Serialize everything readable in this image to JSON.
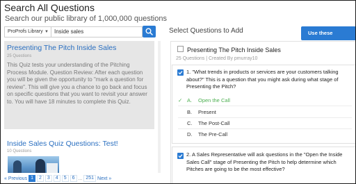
{
  "header": {
    "title": "Search All Questions",
    "subtitle": "Search our public library of 1,000,000 questions"
  },
  "search": {
    "library_label": "ProProfs Library",
    "query": "Inside sales"
  },
  "results": [
    {
      "title": "Presenting The Pitch Inside Sales",
      "count": "25 Questions",
      "description": "This Quiz tests your understanding of the Pitching Process Module. Question Review:  After each question you will be given the opportunity to \"mark a question for review\". This will give you a chance to go back and focus on specific questions that you want to revisit your answer to. You will have 18 minutes to complete this Quiz."
    },
    {
      "title": "Inside Sales Quiz Questions: Test!",
      "count": "10 Questions"
    }
  ],
  "pagination": {
    "prev": "« Previous",
    "pages": [
      "1",
      "2",
      "3",
      "4",
      "5",
      "6"
    ],
    "ellipsis": "...",
    "last": "251",
    "next": "Next »"
  },
  "selection": {
    "heading": "Select Questions to Add",
    "use_button": "Use these questions",
    "quiz_title": "Presenting The Pitch Inside Sales",
    "quiz_meta": "25 Questions | Created By pmurray10",
    "questions": [
      {
        "number": "1.",
        "text": "\"What trends in products or services are your customers talking about?\" This is a question that you might ask during what stage of Presenting the Pitch?",
        "options": [
          {
            "letter": "A.",
            "text": "Open the Call",
            "correct": true
          },
          {
            "letter": "B.",
            "text": "Present",
            "correct": false
          },
          {
            "letter": "C.",
            "text": "The Post-Call",
            "correct": false
          },
          {
            "letter": "D.",
            "text": "The Pre-Call",
            "correct": false
          }
        ]
      },
      {
        "number": "2.",
        "text": "A Sales Representative will ask questions in the \"Open the Inside Sales Call\" stage of Presenting the Pitch to help determine which Pitches are going to be the most effective?"
      }
    ]
  },
  "colors": {
    "accent": "#2a7bd3",
    "link": "#2a6fc0",
    "correct": "#4caf50"
  }
}
